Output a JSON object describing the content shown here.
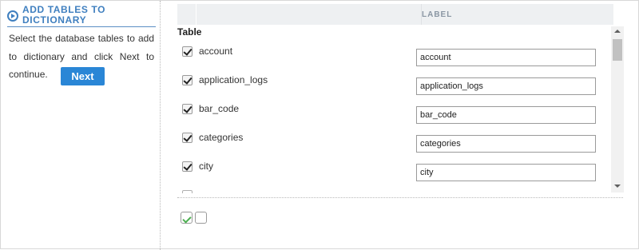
{
  "panel": {
    "title": "ADD TABLES TO DICTIONARY",
    "description": "Select the database tables to add to dictionary and click Next to continue.",
    "next_label": "Next"
  },
  "grid": {
    "label_header": "LABEL",
    "table_header": "Table",
    "rows": [
      {
        "name": "account",
        "label": "account",
        "checked": true
      },
      {
        "name": "application_logs",
        "label": "application_logs",
        "checked": true
      },
      {
        "name": "bar_code",
        "label": "bar_code",
        "checked": true
      },
      {
        "name": "categories",
        "label": "categories",
        "checked": true
      },
      {
        "name": "city",
        "label": "city",
        "checked": true
      }
    ]
  },
  "icons": {
    "panel_icon": "play-circle-icon",
    "check_all": "check-all-icon",
    "uncheck_all": "uncheck-all-icon"
  },
  "colors": {
    "accent": "#3f7fbf",
    "button": "#2a86d6",
    "header_bg": "#eef0f2"
  }
}
